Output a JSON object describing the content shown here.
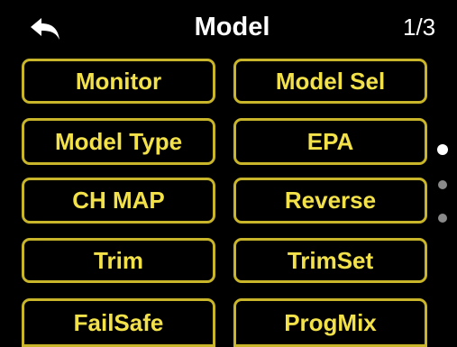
{
  "header": {
    "title": "Model",
    "page_indicator": "1/3",
    "back_icon": "back-arrow-icon"
  },
  "menu": {
    "items": [
      {
        "label": "Monitor"
      },
      {
        "label": "Model Sel"
      },
      {
        "label": "Model Type"
      },
      {
        "label": "EPA"
      },
      {
        "label": "CH MAP"
      },
      {
        "label": "Reverse"
      },
      {
        "label": "Trim"
      },
      {
        "label": "TrimSet"
      },
      {
        "label": "FailSafe"
      },
      {
        "label": "ProgMix"
      }
    ]
  },
  "pager": {
    "pages": 3,
    "active_page": 1
  },
  "colors": {
    "background": "#000000",
    "button_border": "#c9b52a",
    "button_text": "#f3e14a",
    "title_text": "#ffffff",
    "dot_active": "#ffffff",
    "dot_inactive": "#8a8a8a"
  }
}
